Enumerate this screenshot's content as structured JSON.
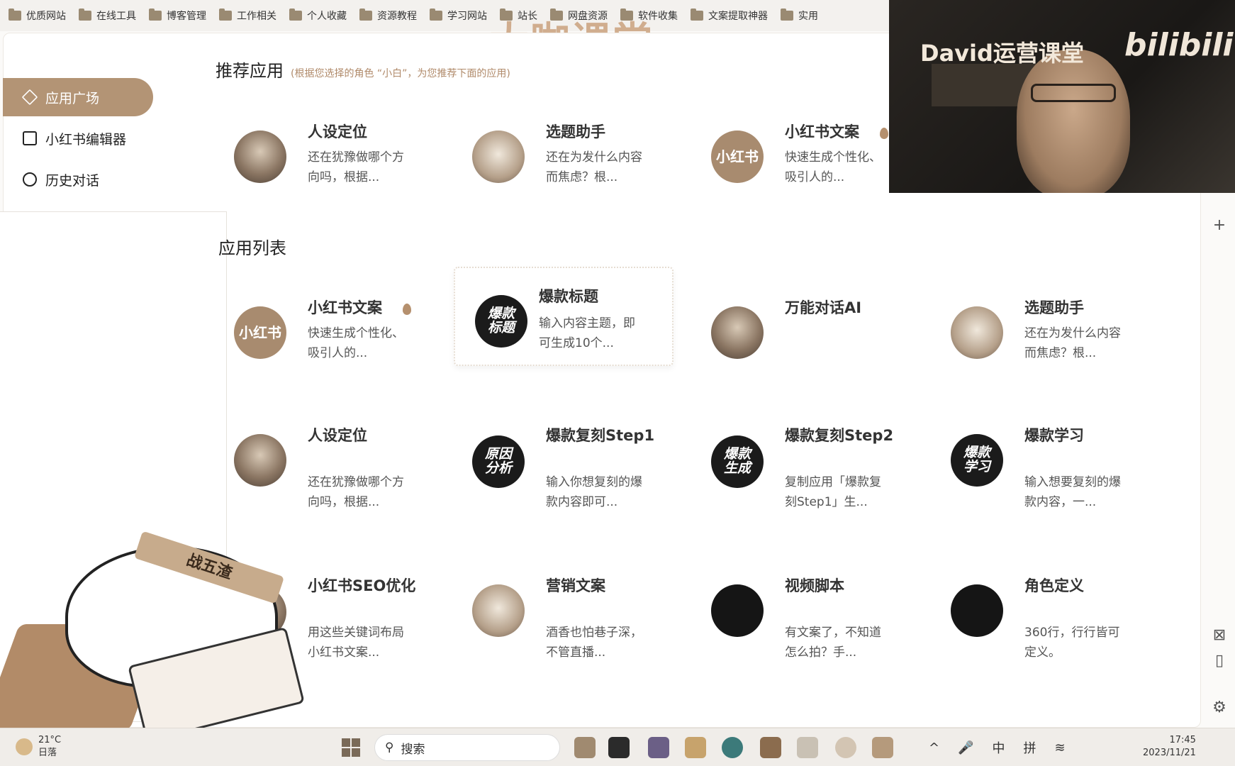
{
  "bookmarks": [
    "优质网站",
    "在线工具",
    "博客管理",
    "工作相关",
    "个人收藏",
    "资源教程",
    "学习网站",
    "站长",
    "网盘资源",
    "软件收集",
    "文案提取神器",
    "实用"
  ],
  "watermark": "大咖课堂",
  "webcam": {
    "title": "David运营课堂",
    "logo": "bilibili"
  },
  "sidebar": {
    "items": [
      {
        "label": "应用广场",
        "icon": "cube-icon"
      },
      {
        "label": "小红书编辑器",
        "icon": "edit-icon"
      },
      {
        "label": "历史对话",
        "icon": "chat-icon"
      }
    ]
  },
  "recommended": {
    "title": "推荐应用",
    "subtitle": "(根据您选择的角色 “小白”，为您推荐下面的应用)",
    "cards": [
      {
        "title": "人设定位",
        "desc": "还在犹豫做哪个方向吗，根据...",
        "avatar_text": "",
        "avatar_style": "av-photo"
      },
      {
        "title": "选题助手",
        "desc": "还在为发什么内容而焦虑？根...",
        "avatar_text": "",
        "avatar_style": "av-photo2"
      },
      {
        "title": "小红书文案",
        "desc": "快速生成个性化、吸引人的...",
        "avatar_text": "小红书",
        "avatar_style": "av-tan"
      }
    ]
  },
  "app_list": {
    "title": "应用列表",
    "cards": [
      {
        "title": "小红书文案",
        "desc": "快速生成个性化、吸引人的...",
        "avatar_text": "小红书",
        "avatar_style": "av-tan"
      },
      {
        "title": "爆款标题",
        "desc": "输入内容主题，即可生成10个...",
        "avatar_text": "爆款\n标题",
        "avatar_style": "av-dark"
      },
      {
        "title": "万能对话AI",
        "desc": "",
        "avatar_text": "",
        "avatar_style": "av-photo"
      },
      {
        "title": "选题助手",
        "desc": "还在为发什么内容而焦虑？根...",
        "avatar_text": "",
        "avatar_style": "av-photo2"
      },
      {
        "title": "人设定位",
        "desc": "还在犹豫做哪个方向吗，根据...",
        "avatar_text": "",
        "avatar_style": "av-photo"
      },
      {
        "title": "爆款复刻Step1",
        "desc": "输入你想复刻的爆款内容即可...",
        "avatar_text": "原因\n分析",
        "avatar_style": "av-dark"
      },
      {
        "title": "爆款复刻Step2",
        "desc": "复制应用「爆款复刻Step1」生...",
        "avatar_text": "爆款\n生成",
        "avatar_style": "av-dark"
      },
      {
        "title": "爆款学习",
        "desc": "输入想要复刻的爆款内容，一...",
        "avatar_text": "爆款\n学习",
        "avatar_style": "av-dark"
      },
      {
        "title": "小红书SEO优化",
        "desc": "用这些关键词布局小红书文案...",
        "avatar_text": "",
        "avatar_style": "av-photo"
      },
      {
        "title": "营销文案",
        "desc": "酒香也怕巷子深，不管直播...",
        "avatar_text": "",
        "avatar_style": "av-photo2"
      },
      {
        "title": "视频脚本",
        "desc": "有文案了，不知道怎么拍？手...",
        "avatar_text": "",
        "avatar_style": "av-black"
      },
      {
        "title": "角色定义",
        "desc": "360行，行行皆可定义。",
        "avatar_text": "",
        "avatar_style": "av-black"
      }
    ]
  },
  "sticker": {
    "band_text": "战五渣"
  },
  "taskbar": {
    "weather_temp": "21°C",
    "weather_desc": "日落",
    "search_placeholder": "搜索",
    "ime_lang": "中",
    "ime_mode": "拼",
    "time": "17:45",
    "date": "2023/11/21"
  }
}
